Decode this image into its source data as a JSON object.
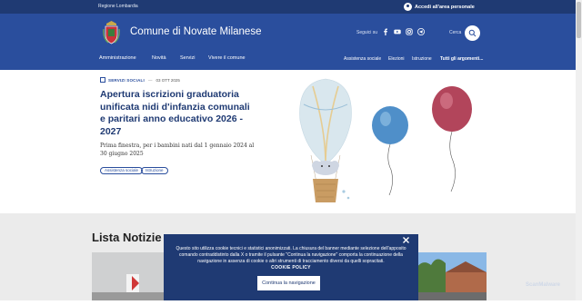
{
  "topbar": {
    "region": "Regione Lombardia",
    "login": "Accedi all'area personale"
  },
  "header": {
    "title": "Comune di Novate Milanese",
    "follow_label": "Seguici su",
    "search_label": "Cerca",
    "social": [
      "facebook-icon",
      "youtube-icon",
      "instagram-icon",
      "telegram-icon"
    ],
    "nav_main": [
      "Amministrazione",
      "Novità",
      "Servizi",
      "Vivere il comune"
    ],
    "nav_secondary": [
      "Assistenza sociale",
      "Elezioni",
      "Istruzione",
      "Tutti gli argomenti..."
    ]
  },
  "hero": {
    "category": "SERVIZI SOCIALI",
    "date": "03 OTT 2025",
    "title": "Apertura iscrizioni graduatoria unificata nidi d'infanzia comunali e paritari anno educativo 2026 - 2027",
    "description": "Prima finestra, per i bambini nati dal 1 gennaio 2024 al 30 giugno 2025",
    "tags": [
      "Assistenza sociale",
      "Istruzione"
    ]
  },
  "news": {
    "title": "Lista Notizie"
  },
  "cookie": {
    "text": "Questo sito utilizza cookie tecnici e statistici anonimizzati. La chiusura del banner mediante selezione dell'apposito comando contraddistinto dalla X o tramite il pulsante \"Continua la navigazione\" comporta la continuazione della navigazione in assenza di cookie o altri strumenti di tracciamento diversi da quelli sopracitati.",
    "policy": "COOKIE POLICY",
    "button": "Continua la navigazione"
  },
  "watermark": "ScanMalware",
  "colors": {
    "header": "#2a4e9d",
    "topbar": "#1f3a73",
    "accent": "#1f3a73"
  }
}
